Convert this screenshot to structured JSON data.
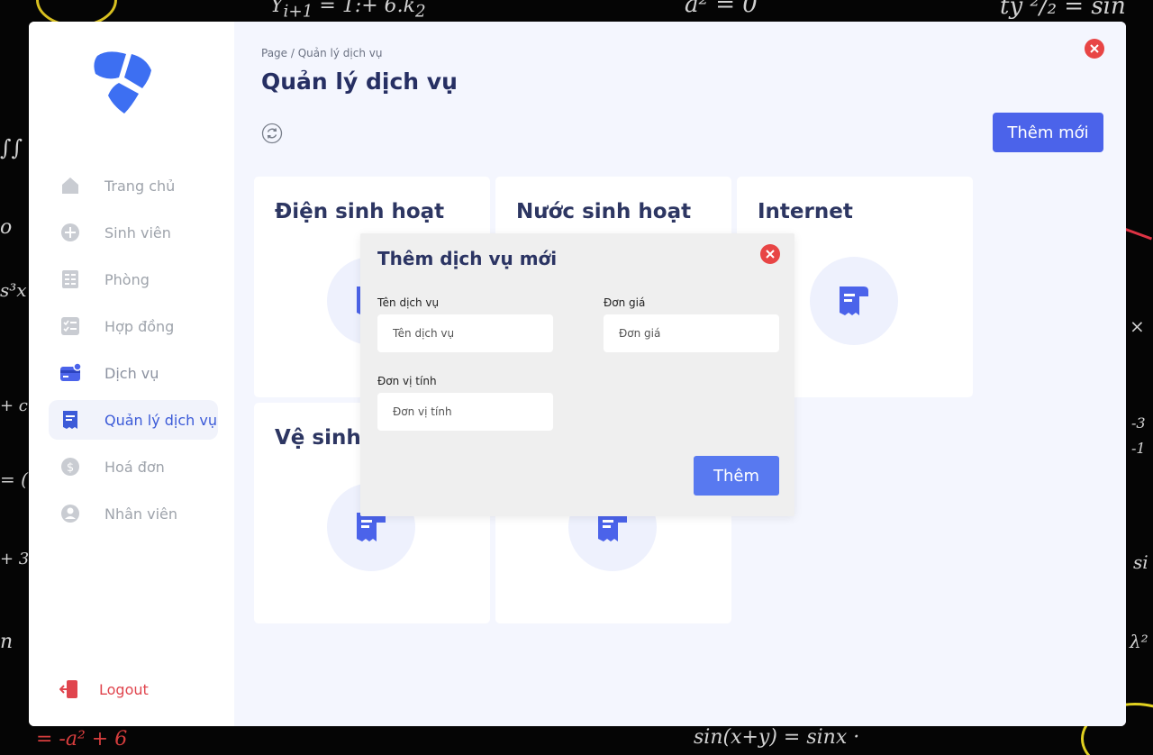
{
  "sidebar": {
    "items": [
      {
        "label": "Trang chủ",
        "icon": "home-icon"
      },
      {
        "label": "Sinh viên",
        "icon": "plus-circle-icon"
      },
      {
        "label": "Phòng",
        "icon": "building-icon"
      },
      {
        "label": "Hợp đồng",
        "icon": "checklist-icon"
      },
      {
        "label": "Dịch vụ",
        "icon": "card-icon"
      },
      {
        "label": "Quản lý dịch vụ",
        "icon": "receipt-icon"
      },
      {
        "label": "Hoá đơn",
        "icon": "dollar-circle-icon"
      },
      {
        "label": "Nhân viên",
        "icon": "user-circle-icon"
      }
    ],
    "active_index": 5,
    "logout_label": "Logout"
  },
  "header": {
    "breadcrumb": "Page / Quản lý dịch vụ",
    "title": "Quản lý dịch vụ",
    "add_button_label": "Thêm mới"
  },
  "services": [
    {
      "name": "Điện sinh hoạt",
      "icon": "receipt-icon"
    },
    {
      "name": "Nước sinh hoạt",
      "icon": "receipt-icon"
    },
    {
      "name": "Internet",
      "icon": "receipt-icon"
    },
    {
      "name": "Vệ sinh",
      "icon": "receipt-icon"
    },
    {
      "name": "",
      "icon": "receipt-icon"
    }
  ],
  "modal": {
    "title": "Thêm dịch vụ mới",
    "fields": {
      "name": {
        "label": "Tên dịch vụ",
        "placeholder": "Tên dịch vụ",
        "value": ""
      },
      "price": {
        "label": "Đơn giá",
        "placeholder": "Đơn giá",
        "value": ""
      },
      "unit": {
        "label": "Đơn vị tính",
        "placeholder": "Đơn vị tính",
        "value": ""
      }
    },
    "submit_label": "Thêm"
  },
  "colors": {
    "accent": "#4b63ea",
    "active_text": "#3c5bd8",
    "danger": "#e84545",
    "title": "#262f63"
  }
}
